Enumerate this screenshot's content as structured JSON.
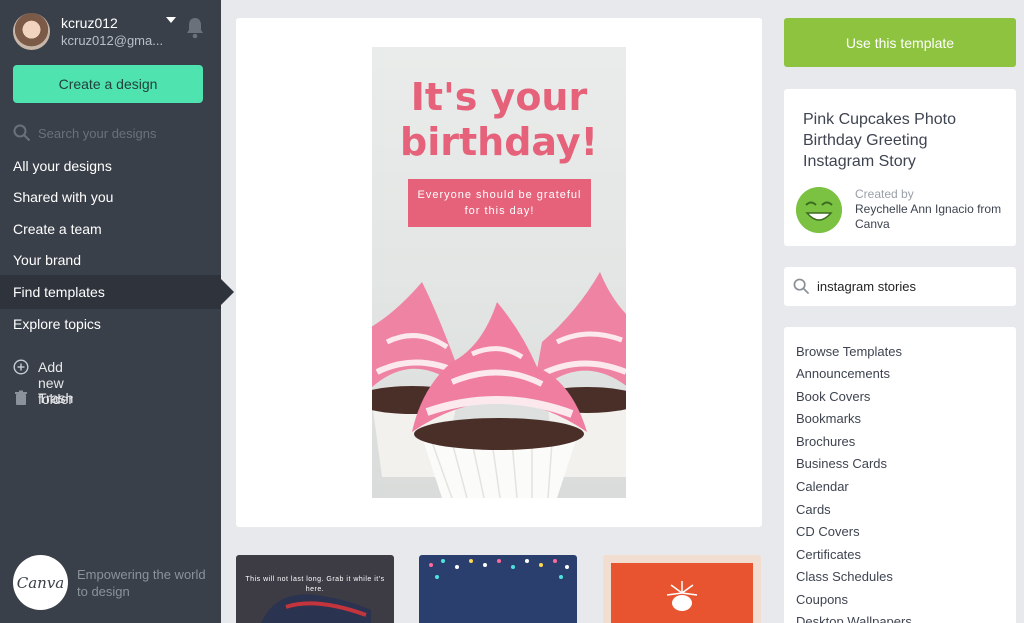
{
  "user": {
    "username": "kcruz012",
    "email": "kcruz012@gma..."
  },
  "sidebar": {
    "create_button": "Create a design",
    "search_placeholder": "Search your designs",
    "nav": [
      {
        "label": "All your designs"
      },
      {
        "label": "Shared with you"
      },
      {
        "label": "Create a team"
      },
      {
        "label": "Your brand"
      },
      {
        "label": "Find templates",
        "active": true
      },
      {
        "label": "Explore topics"
      }
    ],
    "add_folder": "Add new folder",
    "trash": "Trash",
    "brand_logo": "Canva",
    "brand_tagline": "Empowering the world to design"
  },
  "preview": {
    "title": "It's your birthday!",
    "subtitle": "Everyone should be grateful for this day!"
  },
  "thumbnails": [
    {
      "text": "This will not last long. Grab it while it's here."
    },
    {
      "text": ""
    },
    {
      "text": ""
    }
  ],
  "details": {
    "use_button": "Use this template",
    "template_title": "Pink Cupcakes Photo Birthday Greeting Instagram Story",
    "created_by_label": "Created by",
    "creator": "Reychelle Ann Ignacio from Canva"
  },
  "template_search": {
    "value": "instagram stories"
  },
  "categories": [
    "Browse Templates",
    "Announcements",
    "Book Covers",
    "Bookmarks",
    "Brochures",
    "Business Cards",
    "Calendar",
    "Cards",
    "CD Covers",
    "Certificates",
    "Class Schedules",
    "Coupons",
    "Desktop Wallpapers"
  ],
  "colors": {
    "sidebar_bg": "#3a4049",
    "create_button": "#4fe3b0",
    "use_button": "#8dc33e",
    "accent_pink": "#e5627a"
  }
}
